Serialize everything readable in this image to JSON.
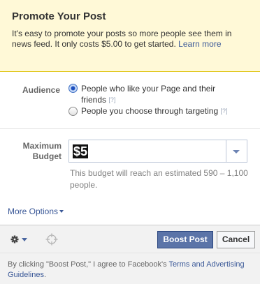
{
  "header": {
    "title": "Promote Your Post",
    "description": "It's easy to promote your posts so more people see them in news feed. It only costs $5.00 to get started.",
    "learn_more": "Learn more"
  },
  "audience": {
    "label": "Audience",
    "options": [
      {
        "label": "People who like your Page and their friends",
        "help": "[?]",
        "selected": true
      },
      {
        "label": "People you choose through targeting",
        "help": "[?]",
        "selected": false
      }
    ]
  },
  "budget": {
    "label_line1": "Maximum",
    "label_line2": "Budget",
    "value": "$5",
    "note": "This budget will reach an estimated 590 – 1,100 people."
  },
  "more_options": "More Options",
  "footer": {
    "boost_label": "Boost Post",
    "cancel_label": "Cancel",
    "icons": [
      "gear-icon",
      "chevron-down-icon",
      "crosshair-icon"
    ]
  },
  "disclaimer": {
    "text": "By clicking \"Boost Post,\" I agree to Facebook's ",
    "link": "Terms and Advertising Guidelines",
    "end": "."
  },
  "colors": {
    "link": "#3b5998",
    "header_bg": "#fff9d7",
    "header_border": "#e2c822",
    "primary_button": "#5b74a8"
  }
}
